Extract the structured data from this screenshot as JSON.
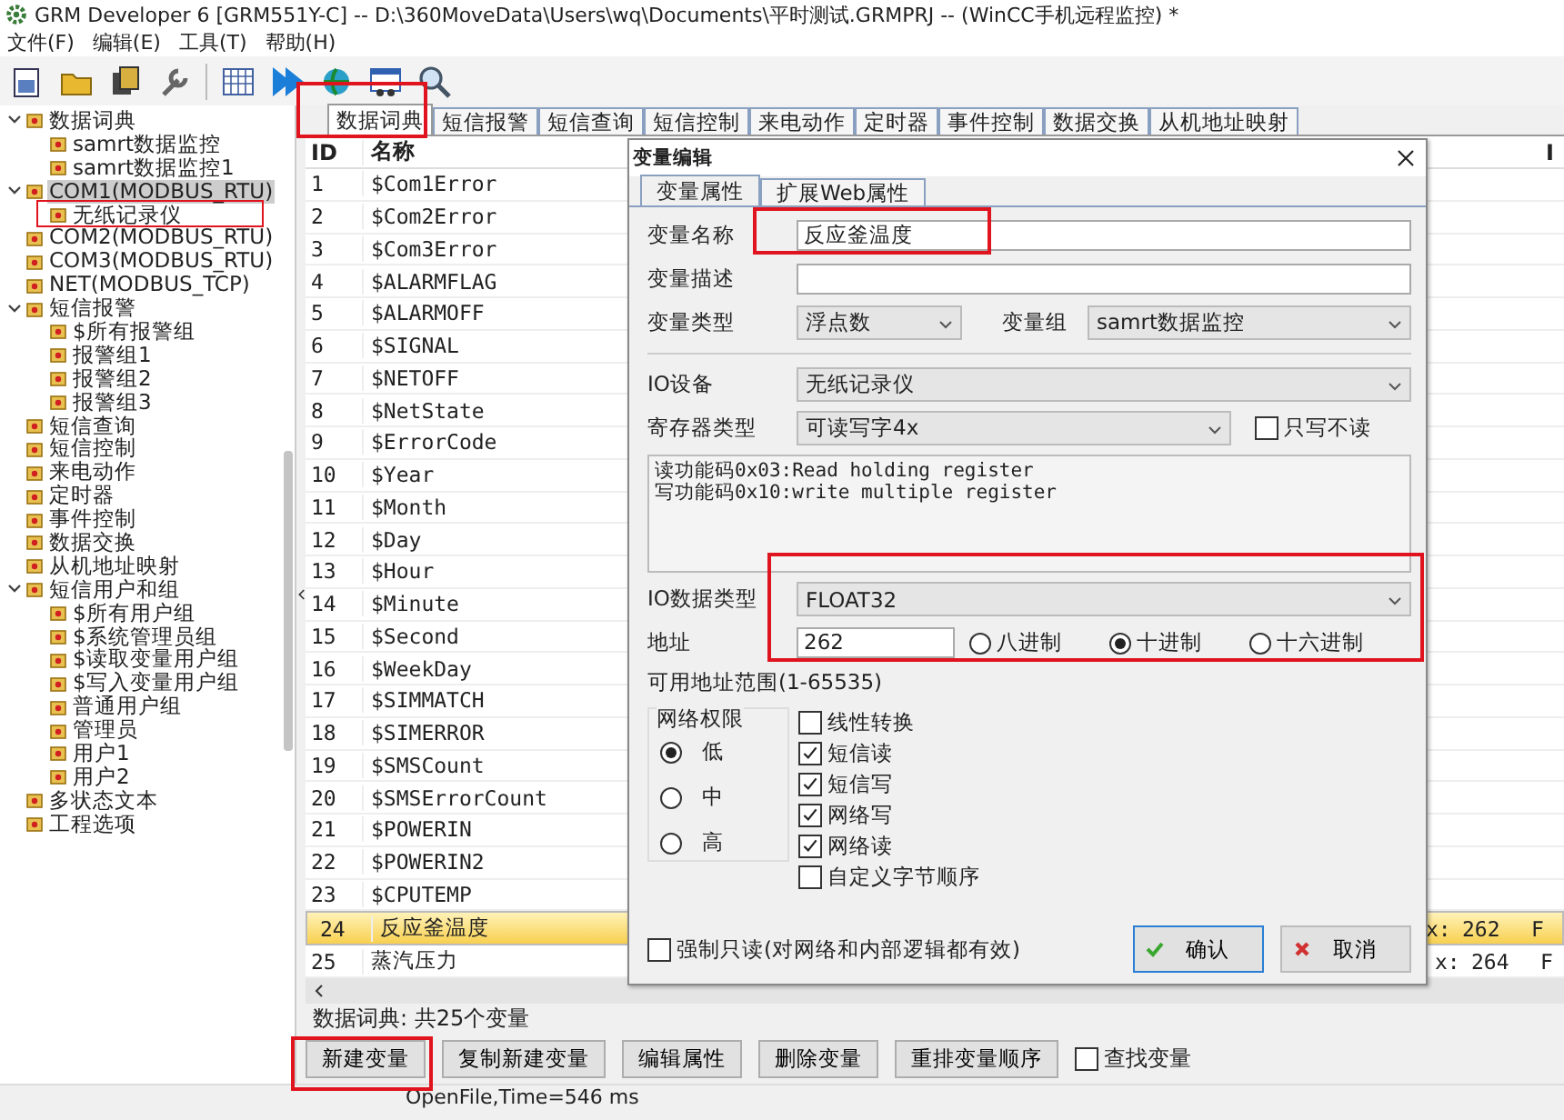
{
  "window": {
    "title": "GRM Developer 6 [GRM551Y-C]  -- D:\\360MoveData\\Users\\wq\\Documents\\平时测试.GRMPRJ -- (WinCC手机远程监控) *"
  },
  "menu": [
    "文件(F)",
    "编辑(E)",
    "工具(T)",
    "帮助(H)"
  ],
  "tree": [
    {
      "label": "数据词典",
      "expanded": true,
      "selected": false,
      "children": [
        {
          "label": "samrt数据监控",
          "selected": false
        },
        {
          "label": "samrt数据监控1",
          "selected": false
        }
      ]
    },
    {
      "label": "COM1(MODBUS_RTU)",
      "expanded": true,
      "selected": true,
      "children": [
        {
          "label": "无纸记录仪",
          "selected": false
        }
      ]
    },
    {
      "label": "COM2(MODBUS_RTU)",
      "selected": false
    },
    {
      "label": "COM3(MODBUS_RTU)",
      "selected": false
    },
    {
      "label": "NET(MODBUS_TCP)",
      "selected": false
    },
    {
      "label": "短信报警",
      "expanded": true,
      "selected": false,
      "children": [
        {
          "label": "$所有报警组",
          "selected": false
        },
        {
          "label": "报警组1",
          "selected": false
        },
        {
          "label": "报警组2",
          "selected": false
        },
        {
          "label": "报警组3",
          "selected": false
        }
      ]
    },
    {
      "label": "短信查询",
      "selected": false
    },
    {
      "label": "短信控制",
      "selected": false
    },
    {
      "label": "来电动作",
      "selected": false
    },
    {
      "label": "定时器",
      "selected": false
    },
    {
      "label": "事件控制",
      "selected": false
    },
    {
      "label": "数据交换",
      "selected": false
    },
    {
      "label": "从机地址映射",
      "selected": false
    },
    {
      "label": "短信用户和组",
      "expanded": true,
      "selected": false,
      "children": [
        {
          "label": "$所有用户组",
          "selected": false
        },
        {
          "label": "$系统管理员组",
          "selected": false
        },
        {
          "label": "$读取变量用户组",
          "selected": false
        },
        {
          "label": "$写入变量用户组",
          "selected": false
        },
        {
          "label": "普通用户组",
          "selected": false
        },
        {
          "label": "管理员",
          "selected": false
        },
        {
          "label": "用户1",
          "selected": false
        },
        {
          "label": "用户2",
          "selected": false
        }
      ]
    },
    {
      "label": "多状态文本",
      "selected": false
    },
    {
      "label": "工程选项",
      "selected": false
    }
  ],
  "tabs": [
    {
      "label": "数据词典",
      "selected": true
    },
    {
      "label": "短信报警",
      "selected": false
    },
    {
      "label": "短信查询",
      "selected": false
    },
    {
      "label": "短信控制",
      "selected": false
    },
    {
      "label": "来电动作",
      "selected": false
    },
    {
      "label": "定时器",
      "selected": false
    },
    {
      "label": "事件控制",
      "selected": false
    },
    {
      "label": "数据交换",
      "selected": false
    },
    {
      "label": "从机地址映射",
      "selected": false
    }
  ],
  "table": {
    "columns": [
      "ID",
      "名称",
      "I"
    ],
    "rows": [
      {
        "id": "1",
        "name": "$Com1Error",
        "selected": false
      },
      {
        "id": "2",
        "name": "$Com2Error",
        "selected": false
      },
      {
        "id": "3",
        "name": "$Com3Error",
        "selected": false
      },
      {
        "id": "4",
        "name": "$ALARMFLAG",
        "selected": false
      },
      {
        "id": "5",
        "name": "$ALARMOFF",
        "selected": false
      },
      {
        "id": "6",
        "name": "$SIGNAL",
        "selected": false
      },
      {
        "id": "7",
        "name": "$NETOFF",
        "selected": false
      },
      {
        "id": "8",
        "name": "$NetState",
        "selected": false
      },
      {
        "id": "9",
        "name": "$ErrorCode",
        "selected": false
      },
      {
        "id": "10",
        "name": "$Year",
        "selected": false
      },
      {
        "id": "11",
        "name": "$Month",
        "selected": false
      },
      {
        "id": "12",
        "name": "$Day",
        "selected": false
      },
      {
        "id": "13",
        "name": "$Hour",
        "selected": false
      },
      {
        "id": "14",
        "name": "$Minute",
        "selected": false
      },
      {
        "id": "15",
        "name": "$Second",
        "selected": false
      },
      {
        "id": "16",
        "name": "$WeekDay",
        "selected": false
      },
      {
        "id": "17",
        "name": "$SIMMATCH",
        "selected": false
      },
      {
        "id": "18",
        "name": "$SIMERROR",
        "selected": false
      },
      {
        "id": "19",
        "name": "$SMSCount",
        "selected": false
      },
      {
        "id": "20",
        "name": "$SMSErrorCount",
        "selected": false
      },
      {
        "id": "21",
        "name": "$POWERIN",
        "selected": false
      },
      {
        "id": "22",
        "name": "$POWERIN2",
        "selected": false
      },
      {
        "id": "23",
        "name": "$CPUTEMP",
        "selected": false
      },
      {
        "id": "24",
        "name": "反应釜温度",
        "selected": true,
        "column_3": "x:",
        "column_4": "262",
        "column_5": "F"
      },
      {
        "id": "25",
        "name": "蒸汽压力",
        "selected": false,
        "column_3": "x:",
        "column_4": "264",
        "column_5": "F"
      }
    ]
  },
  "count_label": "数据词典: 共25个变量",
  "actions": [
    "新建变量",
    "复制新建变量",
    "编辑属性",
    "删除变量",
    "重排变量顺序"
  ],
  "find_option": {
    "label": "查找变量",
    "checked": false
  },
  "status_bar": "OpenFile,Time=546 ms",
  "dialog": {
    "title": "变量编辑",
    "tabs": [
      {
        "label": "变量属性",
        "selected": true
      },
      {
        "label": "扩展Web属性",
        "selected": false
      }
    ],
    "name_field": {
      "label": "变量名称",
      "value": "反应釜温度"
    },
    "description_field": {
      "label": "变量描述"
    },
    "type_field": {
      "label": "变量类型",
      "value": "浮点数"
    },
    "group_field": {
      "label": "变量组",
      "value": "samrt数据监控"
    },
    "io_device": {
      "label": "IO设备",
      "value": "无纸记录仪"
    },
    "register_type": {
      "label": "寄存器类型",
      "value": "可读写字4x"
    },
    "write_only": {
      "label": "只写不读",
      "checked": false
    },
    "function_info": [
      "读功能码0x03:Read holding register",
      "写功能码0x10:write multiple register"
    ],
    "io_data_type": {
      "label": "IO数据类型",
      "value": "FLOAT32"
    },
    "address": {
      "label": "地址",
      "value": "262"
    },
    "bases": [
      {
        "label": "八进制",
        "selected": false
      },
      {
        "label": "十进制",
        "selected": true
      },
      {
        "label": "十六进制",
        "selected": false
      }
    ],
    "address_range": "可用地址范围(1-65535)",
    "permission": {
      "title": "网络权限",
      "options": [
        {
          "label": "低",
          "selected": true
        },
        {
          "label": "中",
          "selected": false
        },
        {
          "label": "高",
          "selected": false
        }
      ]
    },
    "options": [
      {
        "label": "线性转换",
        "checked": false
      },
      {
        "label": "短信读",
        "checked": true
      },
      {
        "label": "短信写",
        "checked": true
      },
      {
        "label": "网络写",
        "checked": true
      },
      {
        "label": "网络读",
        "checked": true
      },
      {
        "label": "自定义字节顺序",
        "checked": false
      }
    ],
    "force_readonly": {
      "label": "强制只读(对网络和内部逻辑都有效)",
      "checked": false
    },
    "buttons": [
      {
        "label": "确认",
        "kind": "ok"
      },
      {
        "label": "取消",
        "kind": "cancel"
      }
    ]
  }
}
